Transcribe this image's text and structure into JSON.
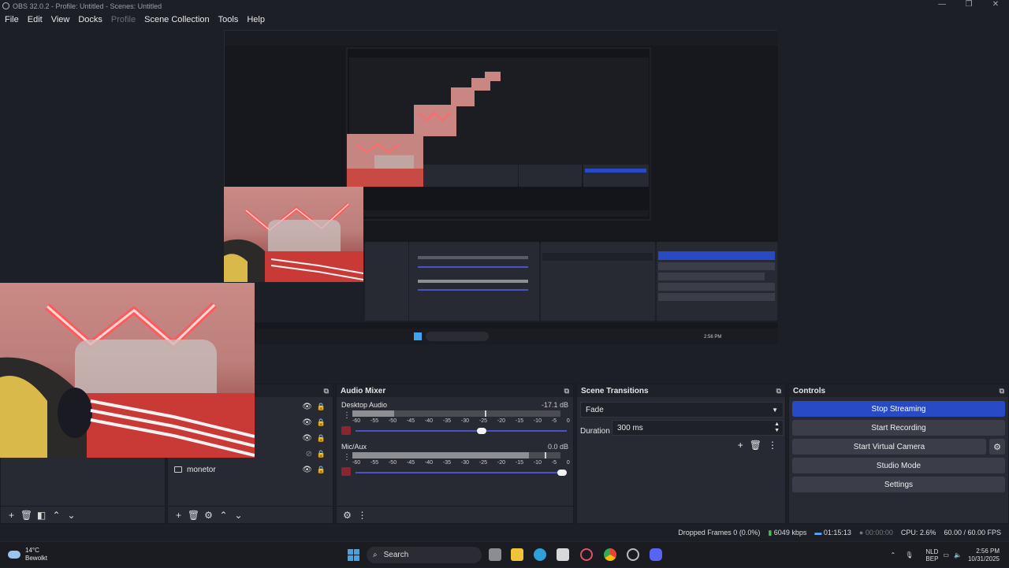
{
  "window": {
    "title": "OBS 32.0.2 - Profile: Untitled - Scenes: Untitled",
    "min": "—",
    "max": "❐",
    "close": "✕"
  },
  "menu": [
    "File",
    "Edit",
    "View",
    "Docks",
    "Profile",
    "Scene Collection",
    "Tools",
    "Help"
  ],
  "mixer": {
    "title": "Audio Mixer",
    "channels": [
      {
        "name": "Desktop Audio",
        "db": "-17.1 dB",
        "level": 0.2,
        "volume": 0.6
      },
      {
        "name": "Mic/Aux",
        "db": "0.0 dB",
        "level": 0.85,
        "volume": 1.0
      }
    ],
    "ticks": [
      "-60",
      "-55",
      "-50",
      "-45",
      "-40",
      "-35",
      "-30",
      "-25",
      "-20",
      "-15",
      "-10",
      "-5",
      "0"
    ]
  },
  "sources": {
    "items": [
      {
        "name": "monetor"
      }
    ]
  },
  "transitions": {
    "title": "Scene Transitions",
    "selected": "Fade",
    "duration_label": "Duration",
    "duration_value": "300 ms"
  },
  "controls": {
    "title": "Controls",
    "stop_streaming": "Stop Streaming",
    "start_recording": "Start Recording",
    "start_virtual_camera": "Start Virtual Camera",
    "studio_mode": "Studio Mode",
    "settings": "Settings"
  },
  "status": {
    "dropped_frames": "Dropped Frames 0 (0.0%)",
    "bitrate": "6049 kbps",
    "stream_time": "01:15:13",
    "record_time": "00:00:00",
    "cpu": "CPU: 2.6%",
    "fps": "60.00 / 60.00 FPS"
  },
  "taskbar": {
    "temp": "14°C",
    "weather": "Bewolkt",
    "search": "Search",
    "lang_top": "NLD",
    "lang_bottom": "BEP",
    "time": "2:56 PM",
    "date": "10/31/2025"
  },
  "colors": {
    "accent": "#284bc5",
    "background": "#1d1f26",
    "panel": "#272a33",
    "mute": "#8b2530"
  }
}
